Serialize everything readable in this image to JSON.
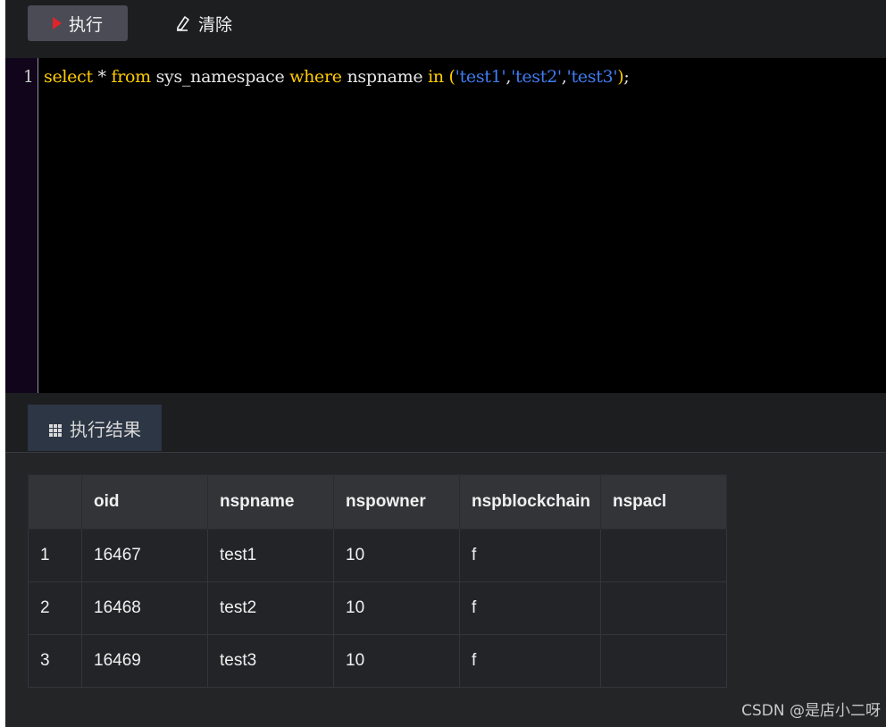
{
  "toolbar": {
    "run_label": "执行",
    "clear_label": "清除"
  },
  "editor": {
    "line_number": "1",
    "tokens": [
      {
        "t": "select",
        "k": "kw"
      },
      {
        "t": " * ",
        "k": "punc"
      },
      {
        "t": "from",
        "k": "kw"
      },
      {
        "t": " sys_namespace ",
        "k": "id"
      },
      {
        "t": "where",
        "k": "kw"
      },
      {
        "t": " nspname ",
        "k": "id"
      },
      {
        "t": "in",
        "k": "kw"
      },
      {
        "t": " (",
        "k": "kw"
      },
      {
        "t": "'test1'",
        "k": "str"
      },
      {
        "t": ",",
        "k": "punc"
      },
      {
        "t": "'test2'",
        "k": "str"
      },
      {
        "t": ",",
        "k": "punc"
      },
      {
        "t": "'test3'",
        "k": "str"
      },
      {
        "t": ")",
        "k": "kw"
      },
      {
        "t": ";",
        "k": "punc"
      }
    ]
  },
  "results": {
    "tab_label": "执行结果",
    "columns": [
      "",
      "oid",
      "nspname",
      "nspowner",
      "nspblockchain",
      "nspacl"
    ],
    "rows": [
      [
        "1",
        "16467",
        "test1",
        "10",
        "f",
        ""
      ],
      [
        "2",
        "16468",
        "test2",
        "10",
        "f",
        ""
      ],
      [
        "3",
        "16469",
        "test3",
        "10",
        "f",
        ""
      ]
    ]
  },
  "watermark": "CSDN @是店小二呀",
  "colors": {
    "keyword": "#ffcc00",
    "string": "#3e7df2",
    "run_icon": "#e0242b"
  },
  "icons": {
    "run": "play-icon",
    "clear": "eraser-icon",
    "results": "grid-icon"
  }
}
